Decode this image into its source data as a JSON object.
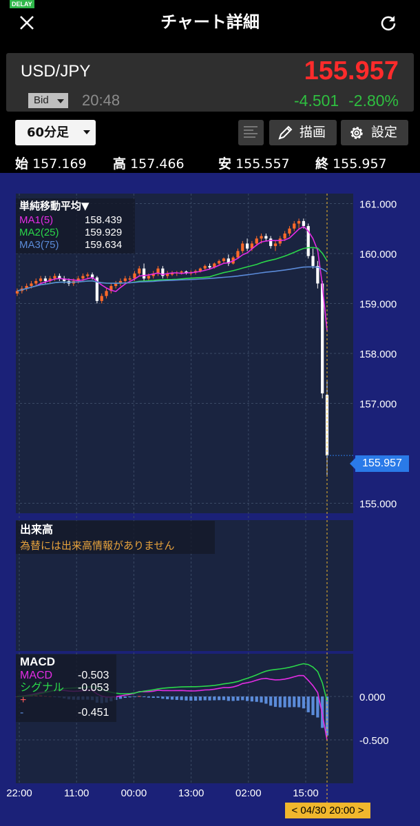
{
  "header": {
    "delay_badge": "DELAY",
    "title": "チャート詳細",
    "close_icon": "close-icon",
    "refresh_icon": "refresh-icon"
  },
  "quote": {
    "symbol": "USD/JPY",
    "price": "155.957",
    "price_type": "Bid",
    "time": "20:48",
    "change": "-4.501",
    "change_pct": "-2.80%",
    "price_color": "#ff2b2b",
    "change_color": "#2fbf40"
  },
  "toolbar": {
    "timeframe": "60分足",
    "draw_label": "描画",
    "settings_label": "設定"
  },
  "ohlc": {
    "open_label": "始",
    "open": "157.169",
    "high_label": "高",
    "high": "157.466",
    "low_label": "安",
    "low": "155.557",
    "close_label": "終",
    "close": "155.957"
  },
  "legend": {
    "ma_header": "単純移動平均▼",
    "ma1_label": "MA1(5)",
    "ma1_value": "158.439",
    "ma2_label": "MA2(25)",
    "ma2_value": "159.929",
    "ma3_label": "MA3(75)",
    "ma3_value": "159.634",
    "volume_header": "出来高",
    "volume_message": "為替には出来高情報がありません",
    "macd_header": "MACD",
    "macd_label": "MACD",
    "macd_value": "-0.503",
    "signal_label": "シグナル",
    "signal_value": "-0.053",
    "hist_plus": "+",
    "hist_minus": "-",
    "hist_value": "-0.451"
  },
  "price_label": "155.957",
  "cursor_date": "< 04/30 20:00 >",
  "colors": {
    "background": "#1b2178",
    "panel": "#1a2440",
    "up": "#ff6a2a",
    "down": "#ffffff",
    "ma1": "#e52ce5",
    "ma2": "#2bd84a",
    "ma3": "#5b8bd9",
    "price_label": "#2a7ae8",
    "cursor": "#f0b72d"
  },
  "chart_data": [
    {
      "type": "candlestick",
      "price_axis": {
        "ticks": [
          "161.000",
          "160.000",
          "159.000",
          "158.000",
          "157.000",
          "155.000"
        ],
        "range": [
          154.8,
          161.2
        ]
      },
      "time_axis": [
        "22:00",
        "11:00",
        "00:00",
        "13:00",
        "02:00",
        "15:00"
      ],
      "series": [
        {
          "name": "MA1(5)",
          "color": "#e52ce5"
        },
        {
          "name": "MA2(25)",
          "color": "#2bd84a"
        },
        {
          "name": "MA3(75)",
          "color": "#5b8bd9"
        }
      ],
      "candles": [
        [
          159.2,
          159.3,
          159.15,
          159.25
        ],
        [
          159.25,
          159.35,
          159.2,
          159.3
        ],
        [
          159.3,
          159.4,
          159.25,
          159.35
        ],
        [
          159.35,
          159.45,
          159.3,
          159.4
        ],
        [
          159.4,
          159.5,
          159.35,
          159.45
        ],
        [
          159.45,
          159.55,
          159.4,
          159.5
        ],
        [
          159.5,
          159.55,
          159.4,
          159.45
        ],
        [
          159.45,
          159.55,
          159.4,
          159.5
        ],
        [
          159.5,
          159.6,
          159.45,
          159.55
        ],
        [
          159.55,
          159.6,
          159.45,
          159.5
        ],
        [
          159.5,
          159.55,
          159.4,
          159.45
        ],
        [
          159.45,
          159.5,
          159.35,
          159.4
        ],
        [
          159.4,
          159.5,
          159.35,
          159.45
        ],
        [
          159.45,
          159.55,
          159.4,
          159.5
        ],
        [
          159.5,
          159.6,
          159.45,
          159.55
        ],
        [
          159.55,
          159.62,
          159.5,
          159.58
        ],
        [
          159.58,
          159.62,
          159.48,
          159.52
        ],
        [
          159.52,
          159.55,
          159.0,
          159.05
        ],
        [
          159.05,
          159.2,
          159.0,
          159.15
        ],
        [
          159.15,
          159.3,
          159.1,
          159.25
        ],
        [
          159.25,
          159.4,
          159.2,
          159.35
        ],
        [
          159.35,
          159.45,
          159.3,
          159.4
        ],
        [
          159.4,
          159.5,
          159.35,
          159.45
        ],
        [
          159.45,
          159.55,
          159.4,
          159.5
        ],
        [
          159.5,
          159.55,
          159.45,
          159.5
        ],
        [
          159.5,
          159.65,
          159.45,
          159.6
        ],
        [
          159.6,
          159.75,
          159.55,
          159.7
        ],
        [
          159.7,
          159.8,
          159.45,
          159.5
        ],
        [
          159.5,
          159.6,
          159.45,
          159.55
        ],
        [
          159.55,
          159.65,
          159.5,
          159.6
        ],
        [
          159.6,
          159.75,
          159.55,
          159.7
        ],
        [
          159.7,
          159.75,
          159.5,
          159.55
        ],
        [
          159.55,
          159.65,
          159.5,
          159.6
        ],
        [
          159.6,
          159.65,
          159.55,
          159.6
        ],
        [
          159.6,
          159.65,
          159.55,
          159.62
        ],
        [
          159.62,
          159.66,
          159.58,
          159.64
        ],
        [
          159.64,
          159.66,
          159.58,
          159.6
        ],
        [
          159.6,
          159.66,
          159.56,
          159.62
        ],
        [
          159.62,
          159.68,
          159.58,
          159.65
        ],
        [
          159.65,
          159.72,
          159.62,
          159.7
        ],
        [
          159.7,
          159.78,
          159.66,
          159.75
        ],
        [
          159.75,
          159.8,
          159.68,
          159.72
        ],
        [
          159.72,
          159.82,
          159.7,
          159.8
        ],
        [
          159.8,
          159.88,
          159.76,
          159.85
        ],
        [
          159.85,
          159.92,
          159.8,
          159.9
        ],
        [
          159.9,
          159.98,
          159.75,
          159.8
        ],
        [
          159.8,
          159.95,
          159.78,
          159.92
        ],
        [
          159.92,
          160.1,
          159.9,
          160.05
        ],
        [
          160.05,
          160.25,
          160.0,
          160.2
        ],
        [
          160.2,
          160.3,
          160.05,
          160.1
        ],
        [
          160.1,
          160.25,
          160.05,
          160.2
        ],
        [
          160.2,
          160.35,
          160.15,
          160.3
        ],
        [
          160.3,
          160.4,
          160.2,
          160.35
        ],
        [
          160.35,
          160.4,
          160.25,
          160.3
        ],
        [
          160.3,
          160.35,
          160.1,
          160.15
        ],
        [
          160.15,
          160.25,
          160.05,
          160.2
        ],
        [
          160.2,
          160.35,
          160.15,
          160.3
        ],
        [
          160.3,
          160.45,
          160.25,
          160.4
        ],
        [
          160.4,
          160.55,
          160.35,
          160.5
        ],
        [
          160.5,
          160.65,
          160.45,
          160.6
        ],
        [
          160.6,
          160.7,
          160.5,
          160.65
        ],
        [
          160.65,
          160.7,
          160.5,
          160.55
        ],
        [
          160.55,
          160.6,
          159.9,
          159.95
        ],
        [
          159.95,
          160.1,
          159.7,
          159.75
        ],
        [
          159.75,
          159.85,
          159.3,
          159.4
        ],
        [
          159.4,
          159.45,
          157.1,
          157.2
        ],
        [
          157.169,
          157.466,
          155.557,
          155.957
        ]
      ]
    },
    {
      "type": "macd",
      "ticks": [
        "0.000",
        "-0.500"
      ],
      "series": [
        {
          "name": "MACD",
          "value": -0.503,
          "color": "#e52ce5"
        },
        {
          "name": "シグナル",
          "value": -0.053,
          "color": "#2bd84a"
        }
      ],
      "histogram_last": -0.451
    }
  ]
}
